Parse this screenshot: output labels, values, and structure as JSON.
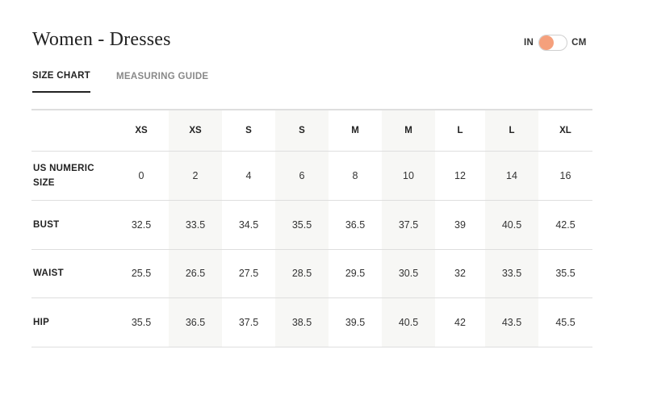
{
  "page": {
    "title": "Women - Dresses"
  },
  "unit_toggle": {
    "left_label": "IN",
    "right_label": "CM",
    "selected": "IN",
    "knob_color": "#f5a07c"
  },
  "tabs": [
    {
      "label": "SIZE CHART",
      "active": true
    },
    {
      "label": "MEASURING GUIDE",
      "active": false
    }
  ],
  "table": {
    "header": [
      "XS",
      "XS",
      "S",
      "S",
      "M",
      "M",
      "L",
      "L",
      "XL"
    ],
    "rows": [
      {
        "label": "US NUMERIC SIZE",
        "values": [
          "0",
          "2",
          "4",
          "6",
          "8",
          "10",
          "12",
          "14",
          "16"
        ]
      },
      {
        "label": "BUST",
        "values": [
          "32.5",
          "33.5",
          "34.5",
          "35.5",
          "36.5",
          "37.5",
          "39",
          "40.5",
          "42.5"
        ]
      },
      {
        "label": "WAIST",
        "values": [
          "25.5",
          "26.5",
          "27.5",
          "28.5",
          "29.5",
          "30.5",
          "32",
          "33.5",
          "35.5"
        ]
      },
      {
        "label": "HIP",
        "values": [
          "35.5",
          "36.5",
          "37.5",
          "38.5",
          "39.5",
          "40.5",
          "42",
          "43.5",
          "45.5"
        ]
      }
    ],
    "shade_color": "#f7f7f5"
  }
}
